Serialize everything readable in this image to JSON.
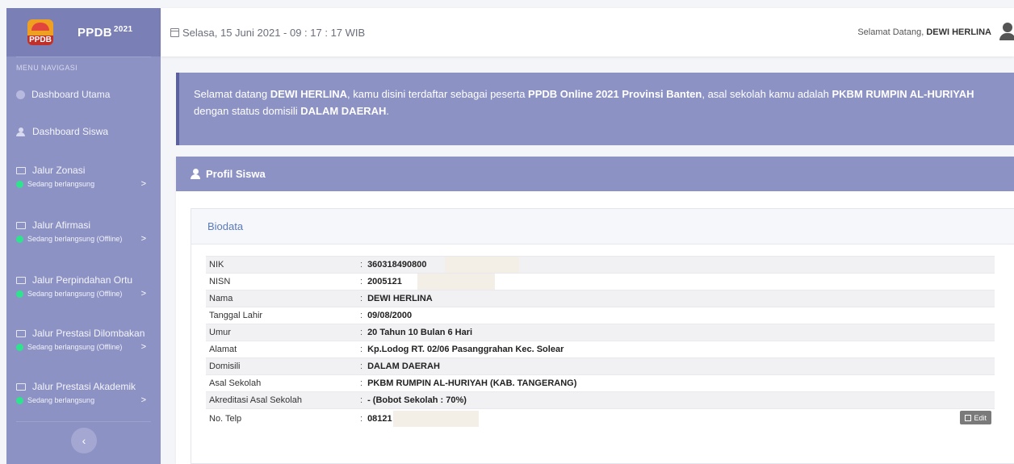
{
  "sidebar": {
    "brand_title": "PPDB",
    "brand_year": "2021",
    "logo_text": "PPDB",
    "menu_heading": "MENU NAVIGASI",
    "items": [
      {
        "label": "Dashboard Utama",
        "icon": "palette-icon"
      },
      {
        "label": "Dashboard Siswa",
        "icon": "user-icon"
      }
    ],
    "groups": [
      {
        "label": "Jalur Zonasi",
        "status": "Sedang berlangsung"
      },
      {
        "label": "Jalur Afirmasi",
        "status": "Sedang berlangsung (Offline)"
      },
      {
        "label": "Jalur Perpindahan Ortu",
        "status": "Sedang berlangsung (Offline)"
      },
      {
        "label": "Jalur Prestasi Dilombakan",
        "status": "Sedang berlangsung (Offline)"
      },
      {
        "label": "Jalur Prestasi Akademik",
        "status": "Sedang berlangsung"
      }
    ],
    "collapse_glyph": "‹"
  },
  "topbar": {
    "date": "Selasa, 15 Juni 2021 - 09 : 17 : 17 WIB",
    "welcome_prefix": "Selamat Datang,",
    "welcome_name": "DEWI HERLINA"
  },
  "alert": {
    "p1": "Selamat datang ",
    "name": "DEWI HERLINA",
    "p2": ", kamu disini terdaftar sebagai peserta ",
    "program": "PPDB Online 2021 Provinsi Banten",
    "p3": ", asal sekolah kamu adalah ",
    "school": "PKBM RUMPIN AL-HURIYAH",
    "p4": " dengan status domisili ",
    "domicile": "DALAM DAERAH",
    "p5": "."
  },
  "profile": {
    "title": "Profil Siswa",
    "section_title": "Biodata",
    "colon": ":",
    "edit_label": "Edit",
    "rows": [
      {
        "label": "NIK",
        "value": "360318490800"
      },
      {
        "label": "NISN",
        "value": "2005121"
      },
      {
        "label": "Nama",
        "value": "DEWI HERLINA"
      },
      {
        "label": "Tanggal Lahir",
        "value": "09/08/2000"
      },
      {
        "label": "Umur",
        "value": "20 Tahun 10 Bulan 6 Hari"
      },
      {
        "label": "Alamat",
        "value": "Kp.Lodog RT. 02/06 Pasanggrahan Kec. Solear"
      },
      {
        "label": "Domisili",
        "value": "DALAM DAERAH"
      },
      {
        "label": "Asal Sekolah",
        "value": "PKBM RUMPIN AL-HURIYAH (KAB. TANGERANG)"
      },
      {
        "label": "Akreditasi Asal Sekolah",
        "value": "- (Bobot Sekolah : 70%)"
      },
      {
        "label": "No. Telp",
        "value": "08121"
      }
    ]
  },
  "colors": {
    "accent": "#8d92c4",
    "accent_dark": "#7a7fb6",
    "status_green": "#2ee38d"
  }
}
